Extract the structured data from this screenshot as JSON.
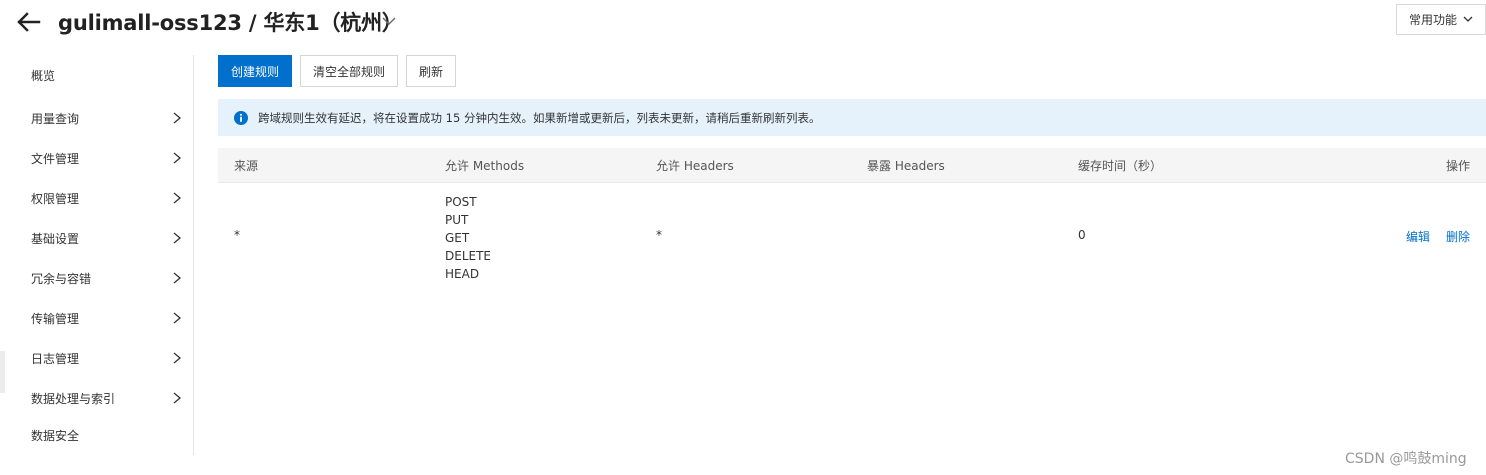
{
  "header": {
    "title": "gulimall-oss123 / 华东1（杭州）",
    "common_functions_label": "常用功能"
  },
  "sidebar": {
    "items": [
      {
        "label": "概览",
        "has_chevron": false
      },
      {
        "label": "用量查询",
        "has_chevron": true
      },
      {
        "label": "文件管理",
        "has_chevron": true
      },
      {
        "label": "权限管理",
        "has_chevron": true
      },
      {
        "label": "基础设置",
        "has_chevron": true
      },
      {
        "label": "冗余与容错",
        "has_chevron": true
      },
      {
        "label": "传输管理",
        "has_chevron": true
      },
      {
        "label": "日志管理",
        "has_chevron": true
      },
      {
        "label": "数据处理与索引",
        "has_chevron": true
      },
      {
        "label": "数据安全",
        "has_chevron": false
      }
    ]
  },
  "toolbar": {
    "create_label": "创建规则",
    "clear_label": "清空全部规则",
    "refresh_label": "刷新"
  },
  "notice": {
    "text": "跨域规则生效有延迟，将在设置成功 15 分钟内生效。如果新增或更新后，列表未更新，请稍后重新刷新列表。"
  },
  "table": {
    "headers": {
      "source": "来源",
      "methods": "允许 Methods",
      "allow_headers": "允许 Headers",
      "expose_headers": "暴露 Headers",
      "cache": "缓存时间（秒）",
      "actions": "操作"
    },
    "rows": [
      {
        "source": "*",
        "methods": [
          "POST",
          "PUT",
          "GET",
          "DELETE",
          "HEAD"
        ],
        "allow_headers": "*",
        "expose_headers": "",
        "cache": "0",
        "edit_label": "编辑",
        "delete_label": "删除"
      }
    ]
  },
  "watermark": "CSDN @鸣鼓ming",
  "colors": {
    "primary": "#0070cc",
    "notice_bg": "#e5f2fc",
    "table_header_bg": "#f5f5f5"
  }
}
